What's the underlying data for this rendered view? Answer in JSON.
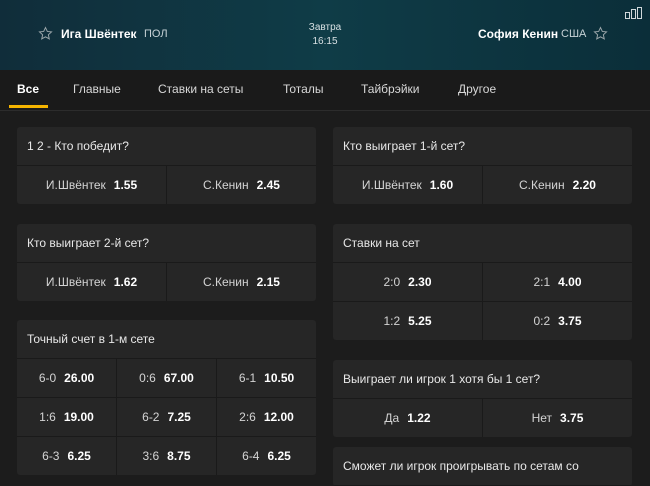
{
  "header": {
    "player1": {
      "name": "Ига Швёнтек",
      "country": "ПОЛ"
    },
    "player2": {
      "name": "София Кенин",
      "country": "США"
    },
    "day": "Завтра",
    "time": "16:15"
  },
  "tabs": [
    "Все",
    "Главные",
    "Ставки на сеты",
    "Тоталы",
    "Тайбрэйки",
    "Другое"
  ],
  "markets": {
    "winner": {
      "title": "1 2 - Кто победит?",
      "rows": [
        [
          {
            "label": "И.Швёнтек",
            "odd": "1.55"
          },
          {
            "label": "С.Кенин",
            "odd": "2.45"
          }
        ]
      ]
    },
    "set2": {
      "title": "Кто выиграет 2-й сет?",
      "rows": [
        [
          {
            "label": "И.Швёнтек",
            "odd": "1.62"
          },
          {
            "label": "С.Кенин",
            "odd": "2.15"
          }
        ]
      ]
    },
    "exact1": {
      "title": "Точный счет в 1-м сете",
      "rows": [
        [
          {
            "label": "6-0",
            "odd": "26.00"
          },
          {
            "label": "0:6",
            "odd": "67.00"
          },
          {
            "label": "6-1",
            "odd": "10.50"
          }
        ],
        [
          {
            "label": "1:6",
            "odd": "19.00"
          },
          {
            "label": "6-2",
            "odd": "7.25"
          },
          {
            "label": "2:6",
            "odd": "12.00"
          }
        ],
        [
          {
            "label": "6-3",
            "odd": "6.25"
          },
          {
            "label": "3:6",
            "odd": "8.75"
          },
          {
            "label": "6-4",
            "odd": "6.25"
          }
        ]
      ]
    },
    "set1": {
      "title": "Кто выиграет 1-й сет?",
      "rows": [
        [
          {
            "label": "И.Швёнтек",
            "odd": "1.60"
          },
          {
            "label": "С.Кенин",
            "odd": "2.20"
          }
        ]
      ]
    },
    "setbets": {
      "title": "Ставки на сет",
      "rows": [
        [
          {
            "label": "2:0",
            "odd": "2.30"
          },
          {
            "label": "2:1",
            "odd": "4.00"
          }
        ],
        [
          {
            "label": "1:2",
            "odd": "5.25"
          },
          {
            "label": "0:2",
            "odd": "3.75"
          }
        ]
      ]
    },
    "p1set": {
      "title": "Выиграет ли игрок 1 хотя бы 1 сет?",
      "rows": [
        [
          {
            "label": "Да",
            "odd": "1.22"
          },
          {
            "label": "Нет",
            "odd": "3.75"
          }
        ]
      ]
    },
    "lose": {
      "title": "Сможет ли игрок проигрывать по сетам со"
    }
  }
}
